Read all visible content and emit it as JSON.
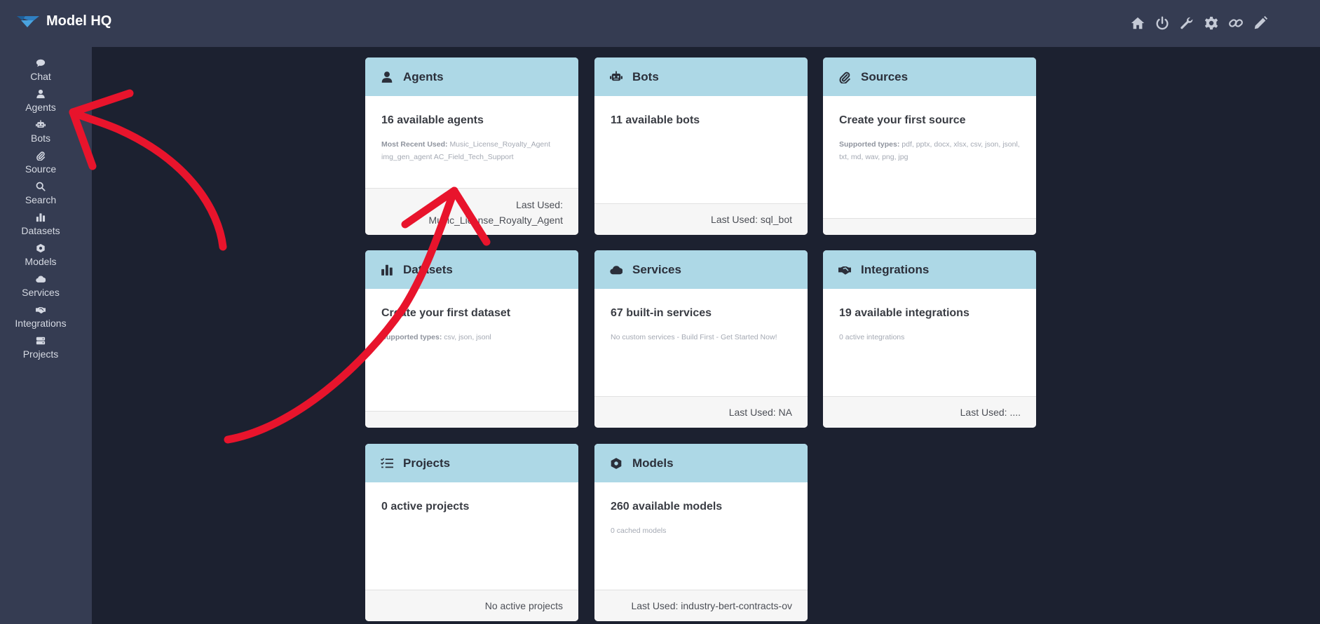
{
  "header": {
    "title": "Model HQ",
    "icons": [
      "home-icon",
      "power-icon",
      "wrench-icon",
      "gear-icon",
      "link-icon",
      "pencil-icon"
    ]
  },
  "sidebar": {
    "items": [
      {
        "label": "Chat",
        "icon": "chat-icon"
      },
      {
        "label": "Agents",
        "icon": "user-icon"
      },
      {
        "label": "Bots",
        "icon": "robot-icon"
      },
      {
        "label": "Source",
        "icon": "paperclip-icon"
      },
      {
        "label": "Search",
        "icon": "search-icon"
      },
      {
        "label": "Datasets",
        "icon": "bar-chart-icon"
      },
      {
        "label": "Models",
        "icon": "cube-icon"
      },
      {
        "label": "Services",
        "icon": "cloud-icon"
      },
      {
        "label": "Integrations",
        "icon": "handshake-icon"
      },
      {
        "label": "Projects",
        "icon": "server-icon"
      }
    ]
  },
  "cards": {
    "agents": {
      "title": "Agents",
      "main": "16 available agents",
      "sub_label": "Most Recent Used:",
      "sub_text": "Music_License_Royalty_Agent img_gen_agent AC_Field_Tech_Support",
      "footer_label": "Last Used:",
      "footer_value": "Music_License_Royalty_Agent"
    },
    "bots": {
      "title": "Bots",
      "main": "11 available bots",
      "footer": "Last Used: sql_bot"
    },
    "sources": {
      "title": "Sources",
      "main": "Create your first source",
      "sub_label": "Supported types:",
      "sub_text": "pdf, pptx, docx, xlsx, csv, json, jsonl, txt, md, wav, png, jpg"
    },
    "datasets": {
      "title": "Datasets",
      "main": "Create your first dataset",
      "sub_label": "Supported types:",
      "sub_text": "csv, json, jsonl"
    },
    "services": {
      "title": "Services",
      "main": "67 built-in services",
      "sub_text": "No custom services - Build First - Get Started Now!",
      "footer": "Last Used: NA"
    },
    "integrations": {
      "title": "Integrations",
      "main": "19 available integrations",
      "sub_text": "0 active integrations",
      "footer": "Last Used: ...."
    },
    "projects": {
      "title": "Projects",
      "main": "0 active projects",
      "footer": "No active projects"
    },
    "models": {
      "title": "Models",
      "main": "260 available models",
      "sub_text": "0 cached models",
      "footer": "Last Used: industry-bert-contracts-ov"
    }
  },
  "annotation_color": "#e8142c"
}
